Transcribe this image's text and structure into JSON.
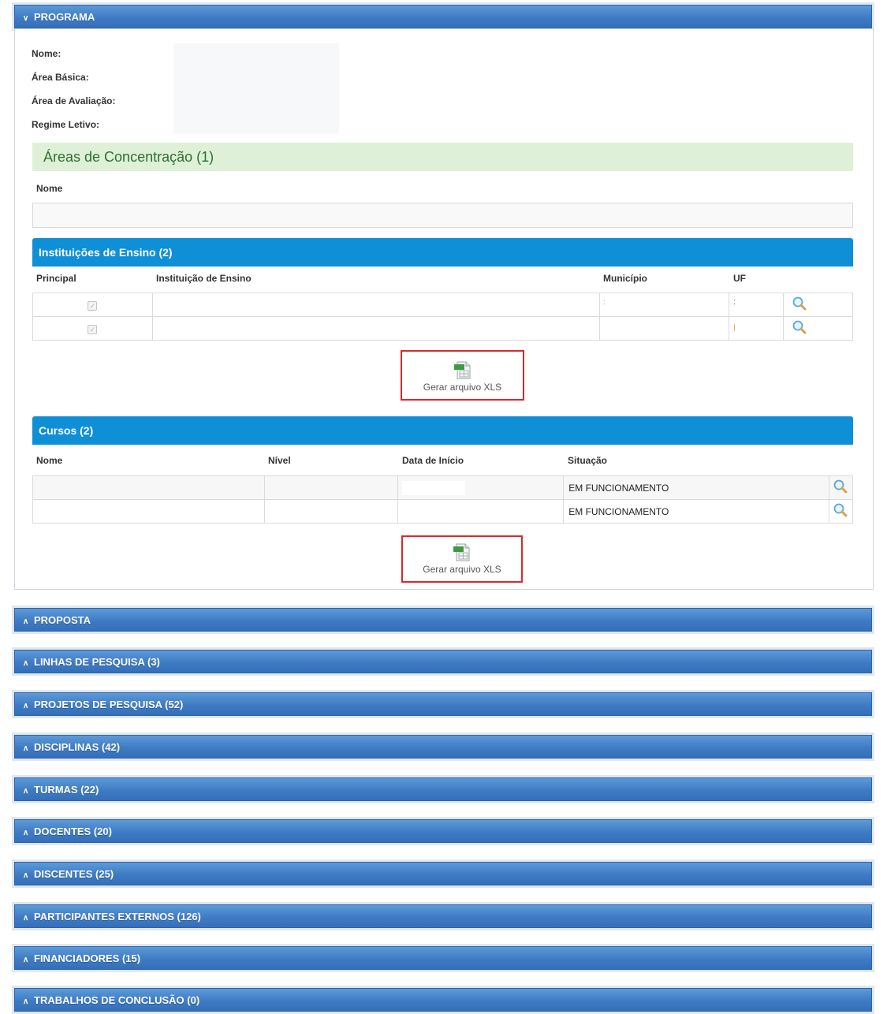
{
  "accordion": {
    "programa": "PROGRAMA",
    "sections": [
      "PROPOSTA",
      "LINHAS DE PESQUISA (3)",
      "PROJETOS DE PESQUISA (52)",
      "DISCIPLINAS (42)",
      "TURMAS (22)",
      "DOCENTES (20)",
      "DISCENTES (25)",
      "PARTICIPANTES EXTERNOS (126)",
      "FINANCIADORES (15)",
      "TRABALHOS DE CONCLUSÃO (0)"
    ]
  },
  "programa": {
    "nome_label": "Nome:",
    "area_basica_label": "Área Básica:",
    "area_avaliacao_label": "Área de Avaliação:",
    "regime_letivo_label": "Regime Letivo:"
  },
  "areas": {
    "title": "Áreas de Concentração (1)",
    "col_nome": "Nome"
  },
  "instituicoes": {
    "title": "Instituições de Ensino (2)",
    "columns": [
      "Principal",
      "Instituição de Ensino",
      "Município",
      "UF"
    ],
    "rows": [
      {
        "principal": true,
        "instituicao": "",
        "municipio": "",
        "uf": ""
      },
      {
        "principal": true,
        "instituicao": "",
        "municipio": "",
        "uf": ""
      }
    ],
    "xls_label": "Gerar arquivo XLS"
  },
  "cursos": {
    "title": "Cursos (2)",
    "columns": [
      "Nome",
      "Nível",
      "Data de Início",
      "Situação"
    ],
    "rows": [
      {
        "nome": "",
        "nivel": "",
        "data": "",
        "situacao": "EM FUNCIONAMENTO"
      },
      {
        "nome": "",
        "nivel": "",
        "data": "",
        "situacao": "EM FUNCIONAMENTO"
      }
    ],
    "xls_label": "Gerar arquivo XLS"
  },
  "colors": {
    "accordion_blue": "#3f7bc4",
    "table_header_blue": "#0f8fd6",
    "green_header_bg": "#dff0d8",
    "xls_border_red": "#d9292c"
  },
  "icons": {
    "chevron_expanded": "chevron-down-double-icon",
    "chevron_collapsed": "chevron-up-double-icon",
    "search": "magnifier-icon",
    "xls": "xls-file-icon"
  }
}
